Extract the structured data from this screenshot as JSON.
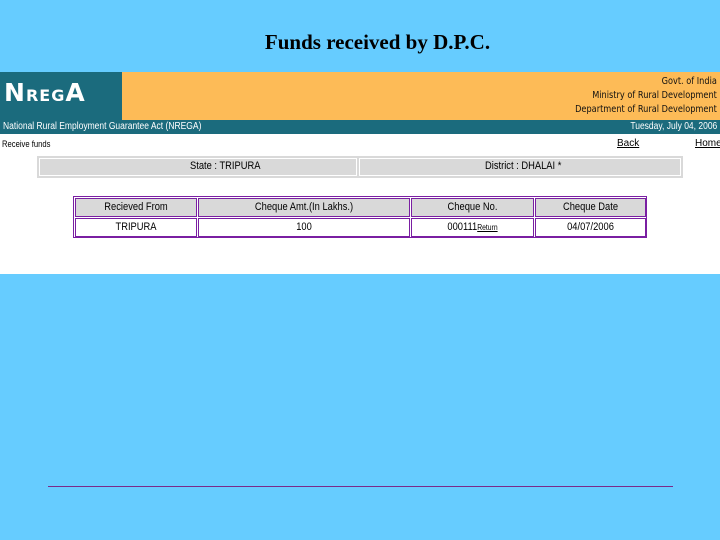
{
  "slide": {
    "title": "Funds received by D.P.C."
  },
  "header": {
    "logo": {
      "n": "N",
      "r": "R",
      "e": "E",
      "g": "G",
      "a": "A"
    },
    "govt": "Govt. of India",
    "ministry": "Ministry of Rural Development",
    "department": "Department of Rural Development",
    "act_name": "National Rural Employment Guarantee Act (NREGA)",
    "date": "Tuesday, July 04, 2006",
    "colors": {
      "teal": "#1b6b7d",
      "orange": "#fdbb57"
    }
  },
  "nav": {
    "page_label": "Receive funds",
    "back_label": "Back",
    "home_label": "Home"
  },
  "location": {
    "state_text": "State : TRIPURA",
    "district_text": "District : DHALAI *"
  },
  "funds_table": {
    "headers": [
      "Recieved From",
      "Cheque Amt.(In Lakhs.)",
      "Cheque No.",
      "Cheque Date"
    ],
    "rows": [
      {
        "from": "TRIPURA",
        "amount": "100",
        "cheque_no": "000111",
        "return_label": "Return",
        "date": "04/07/2006"
      }
    ]
  }
}
